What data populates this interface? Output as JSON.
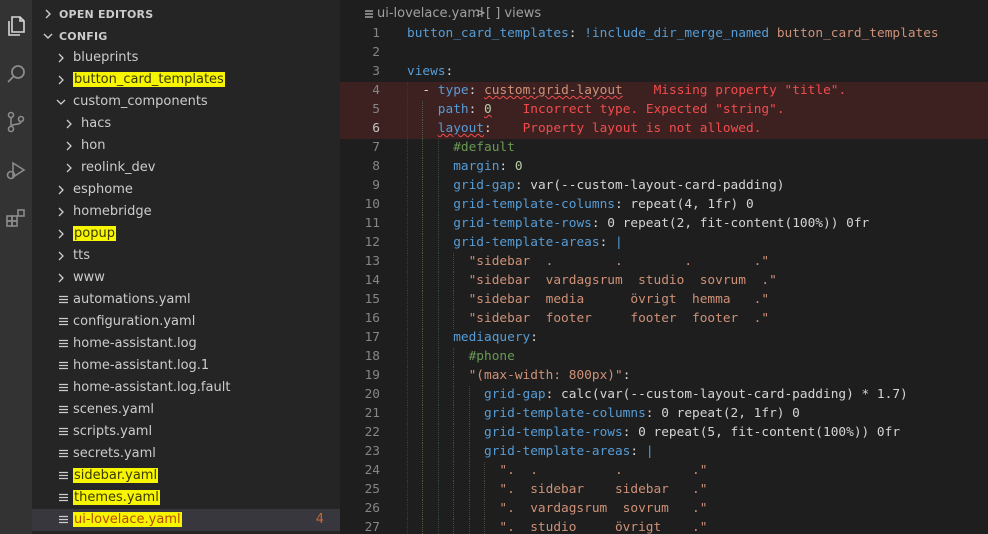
{
  "sidebar": {
    "open_editors": "OPEN EDITORS",
    "config": "CONFIG",
    "items": [
      {
        "label": "blueprints",
        "type": "folder",
        "depth": 1,
        "open": false
      },
      {
        "label": "button_card_templates",
        "type": "folder",
        "depth": 1,
        "open": false,
        "highlight": true
      },
      {
        "label": "custom_components",
        "type": "folder",
        "depth": 1,
        "open": true
      },
      {
        "label": "hacs",
        "type": "folder",
        "depth": 2,
        "open": false
      },
      {
        "label": "hon",
        "type": "folder",
        "depth": 2,
        "open": false
      },
      {
        "label": "reolink_dev",
        "type": "folder",
        "depth": 2,
        "open": false
      },
      {
        "label": "esphome",
        "type": "folder",
        "depth": 1,
        "open": false
      },
      {
        "label": "homebridge",
        "type": "folder",
        "depth": 1,
        "open": false
      },
      {
        "label": "popup",
        "type": "folder",
        "depth": 1,
        "open": false,
        "highlight": true
      },
      {
        "label": "tts",
        "type": "folder",
        "depth": 1,
        "open": false
      },
      {
        "label": "www",
        "type": "folder",
        "depth": 1,
        "open": false
      },
      {
        "label": "automations.yaml",
        "type": "file",
        "depth": 1
      },
      {
        "label": "configuration.yaml",
        "type": "file",
        "depth": 1
      },
      {
        "label": "home-assistant.log",
        "type": "file",
        "depth": 1
      },
      {
        "label": "home-assistant.log.1",
        "type": "file",
        "depth": 1
      },
      {
        "label": "home-assistant.log.fault",
        "type": "file",
        "depth": 1
      },
      {
        "label": "scenes.yaml",
        "type": "file",
        "depth": 1
      },
      {
        "label": "scripts.yaml",
        "type": "file",
        "depth": 1
      },
      {
        "label": "secrets.yaml",
        "type": "file",
        "depth": 1
      },
      {
        "label": "sidebar.yaml",
        "type": "file",
        "depth": 1,
        "highlight": true
      },
      {
        "label": "themes.yaml",
        "type": "file",
        "depth": 1,
        "highlight": true
      },
      {
        "label": "ui-lovelace.yaml",
        "type": "file",
        "depth": 1,
        "highlight": true,
        "selected": true,
        "error": true,
        "badge": "4"
      }
    ]
  },
  "breadcrumb": {
    "file": "ui-lovelace.yaml",
    "separator": ">",
    "symbol": "[ ] views"
  },
  "editor": {
    "current_line": 6,
    "lines": [
      {
        "n": "1",
        "indent": 0,
        "parts": [
          [
            "k",
            "button_card_templates"
          ],
          [
            "p",
            ": "
          ],
          [
            "k",
            "!include_dir_merge_named"
          ],
          [
            "p",
            " "
          ],
          [
            "s",
            "button_card_templates"
          ]
        ]
      },
      {
        "n": "2",
        "indent": 0,
        "parts": []
      },
      {
        "n": "3",
        "indent": 0,
        "parts": [
          [
            "k",
            "views"
          ],
          [
            "p",
            ":"
          ]
        ]
      },
      {
        "n": "4",
        "indent": 1,
        "err": true,
        "parts": [
          [
            "p",
            "- "
          ],
          [
            "k",
            "type"
          ],
          [
            "p",
            ": "
          ],
          [
            "sw",
            "custom:grid-layout"
          ],
          [
            "p",
            "    "
          ],
          [
            "e",
            "Missing property \"title\"."
          ]
        ]
      },
      {
        "n": "5",
        "indent": 2,
        "err": true,
        "parts": [
          [
            "k",
            "path"
          ],
          [
            "p",
            ": "
          ],
          [
            "nw",
            "0"
          ],
          [
            "p",
            "    "
          ],
          [
            "e",
            "Incorrect type. Expected \"string\"."
          ]
        ]
      },
      {
        "n": "6",
        "indent": 2,
        "err": true,
        "parts": [
          [
            "kw",
            "layout"
          ],
          [
            "p",
            ":    "
          ],
          [
            "e",
            "Property layout is not allowed."
          ]
        ]
      },
      {
        "n": "7",
        "indent": 3,
        "parts": [
          [
            "c",
            "#default"
          ]
        ]
      },
      {
        "n": "8",
        "indent": 3,
        "parts": [
          [
            "k",
            "margin"
          ],
          [
            "p",
            ": "
          ],
          [
            "n",
            "0"
          ]
        ]
      },
      {
        "n": "9",
        "indent": 3,
        "parts": [
          [
            "k",
            "grid-gap"
          ],
          [
            "p",
            ": var(--custom-layout-card-padding)"
          ]
        ]
      },
      {
        "n": "10",
        "indent": 3,
        "parts": [
          [
            "k",
            "grid-template-columns"
          ],
          [
            "p",
            ": repeat(4, 1fr) 0"
          ]
        ]
      },
      {
        "n": "11",
        "indent": 3,
        "parts": [
          [
            "k",
            "grid-template-rows"
          ],
          [
            "p",
            ": 0 repeat(2, fit-content(100%)) 0fr"
          ]
        ]
      },
      {
        "n": "12",
        "indent": 3,
        "parts": [
          [
            "k",
            "grid-template-areas"
          ],
          [
            "p",
            ": "
          ],
          [
            "k",
            "|"
          ]
        ]
      },
      {
        "n": "13",
        "indent": 4,
        "parts": [
          [
            "s",
            "\"sidebar  .        .        .        .\""
          ]
        ]
      },
      {
        "n": "14",
        "indent": 4,
        "parts": [
          [
            "s",
            "\"sidebar  vardagsrum  studio  sovrum  .\""
          ]
        ]
      },
      {
        "n": "15",
        "indent": 4,
        "parts": [
          [
            "s",
            "\"sidebar  media      övrigt  hemma   .\""
          ]
        ]
      },
      {
        "n": "16",
        "indent": 4,
        "parts": [
          [
            "s",
            "\"sidebar  footer     footer  footer  .\""
          ]
        ]
      },
      {
        "n": "17",
        "indent": 3,
        "parts": [
          [
            "k",
            "mediaquery"
          ],
          [
            "p",
            ":"
          ]
        ]
      },
      {
        "n": "18",
        "indent": 4,
        "parts": [
          [
            "c",
            "#phone"
          ]
        ]
      },
      {
        "n": "19",
        "indent": 4,
        "parts": [
          [
            "s",
            "\"(max-width: 800px)\""
          ],
          [
            "p",
            ":"
          ]
        ]
      },
      {
        "n": "20",
        "indent": 5,
        "parts": [
          [
            "k",
            "grid-gap"
          ],
          [
            "p",
            ": calc(var(--custom-layout-card-padding) * 1.7)"
          ]
        ]
      },
      {
        "n": "21",
        "indent": 5,
        "parts": [
          [
            "k",
            "grid-template-columns"
          ],
          [
            "p",
            ": 0 repeat(2, 1fr) 0"
          ]
        ]
      },
      {
        "n": "22",
        "indent": 5,
        "parts": [
          [
            "k",
            "grid-template-rows"
          ],
          [
            "p",
            ": 0 repeat(5, fit-content(100%)) 0fr"
          ]
        ]
      },
      {
        "n": "23",
        "indent": 5,
        "parts": [
          [
            "k",
            "grid-template-areas"
          ],
          [
            "p",
            ": "
          ],
          [
            "k",
            "|"
          ]
        ]
      },
      {
        "n": "24",
        "indent": 6,
        "parts": [
          [
            "s",
            "\".  .          .         .\""
          ]
        ]
      },
      {
        "n": "25",
        "indent": 6,
        "parts": [
          [
            "s",
            "\".  sidebar    sidebar   .\""
          ]
        ]
      },
      {
        "n": "26",
        "indent": 6,
        "parts": [
          [
            "s",
            "\".  vardagsrum  sovrum   .\""
          ]
        ]
      },
      {
        "n": "27",
        "indent": 6,
        "parts": [
          [
            "s",
            "\".  studio     övrigt    .\""
          ]
        ]
      }
    ]
  },
  "colors": {
    "activity_bar": "#333333",
    "sidebar_bg": "#252526",
    "editor_bg": "#1e1e1e",
    "highlighter": "#f7f500",
    "error": "#f14c4c"
  },
  "icons": [
    "files-icon",
    "search-icon",
    "source-control-icon",
    "run-debug-icon",
    "extensions-icon"
  ]
}
